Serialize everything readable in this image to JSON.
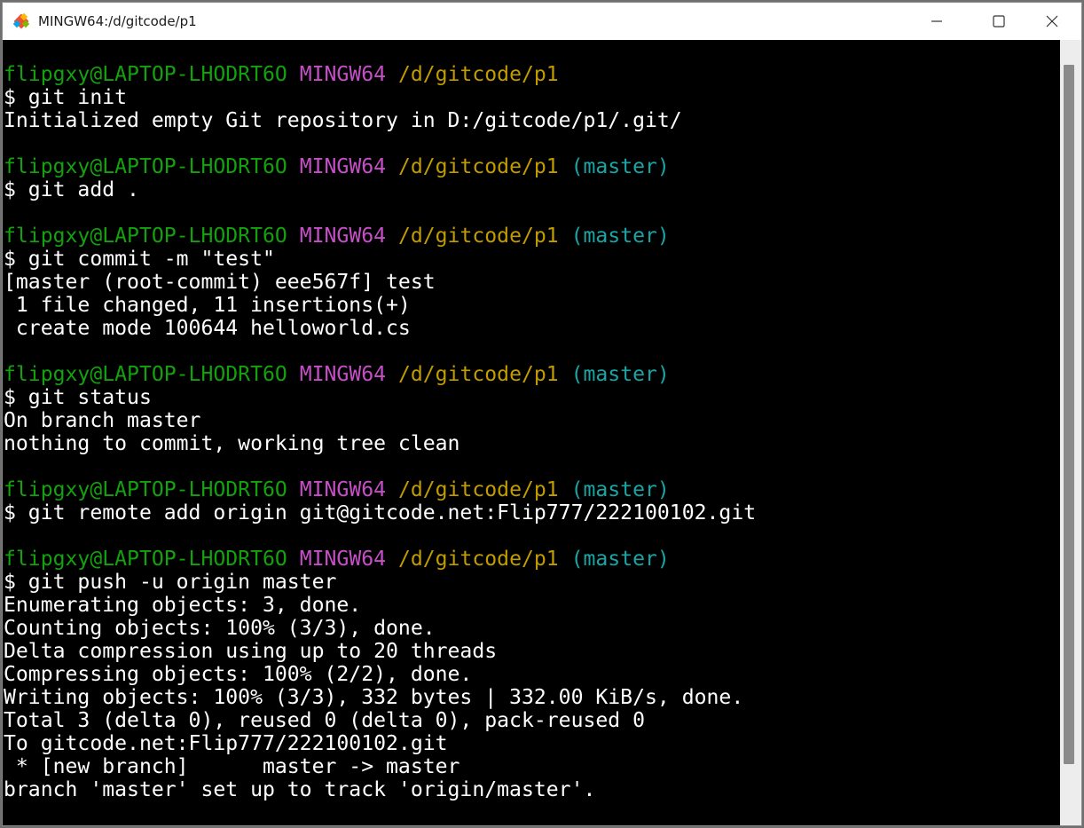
{
  "window": {
    "title": "MINGW64:/d/gitcode/p1"
  },
  "colors": {
    "user": "#13a10e",
    "host": "#c64fc8",
    "path": "#c19c00",
    "branch": "#19a5a5",
    "text": "#ffffff",
    "background": "#000000"
  },
  "icons": {
    "app": "git-icon",
    "minimize": "minimize-icon",
    "maximize": "maximize-icon",
    "close": "close-icon"
  },
  "blocks": [
    {
      "prompt": {
        "user": "flipgxy@LAPTOP-LHODRT6O",
        "host": "MINGW64",
        "path": "/d/gitcode/p1",
        "branch": ""
      },
      "command": "$ git init",
      "output": [
        "Initialized empty Git repository in D:/gitcode/p1/.git/"
      ]
    },
    {
      "prompt": {
        "user": "flipgxy@LAPTOP-LHODRT6O",
        "host": "MINGW64",
        "path": "/d/gitcode/p1",
        "branch": "(master)"
      },
      "command": "$ git add .",
      "output": []
    },
    {
      "prompt": {
        "user": "flipgxy@LAPTOP-LHODRT6O",
        "host": "MINGW64",
        "path": "/d/gitcode/p1",
        "branch": "(master)"
      },
      "command": "$ git commit -m \"test\"",
      "output": [
        "[master (root-commit) eee567f] test",
        " 1 file changed, 11 insertions(+)",
        " create mode 100644 helloworld.cs"
      ]
    },
    {
      "prompt": {
        "user": "flipgxy@LAPTOP-LHODRT6O",
        "host": "MINGW64",
        "path": "/d/gitcode/p1",
        "branch": "(master)"
      },
      "command": "$ git status",
      "output": [
        "On branch master",
        "nothing to commit, working tree clean"
      ]
    },
    {
      "prompt": {
        "user": "flipgxy@LAPTOP-LHODRT6O",
        "host": "MINGW64",
        "path": "/d/gitcode/p1",
        "branch": "(master)"
      },
      "command": "$ git remote add origin git@gitcode.net:Flip777/222100102.git",
      "output": []
    },
    {
      "prompt": {
        "user": "flipgxy@LAPTOP-LHODRT6O",
        "host": "MINGW64",
        "path": "/d/gitcode/p1",
        "branch": "(master)"
      },
      "command": "$ git push -u origin master",
      "output": [
        "Enumerating objects: 3, done.",
        "Counting objects: 100% (3/3), done.",
        "Delta compression using up to 20 threads",
        "Compressing objects: 100% (2/2), done.",
        "Writing objects: 100% (3/3), 332 bytes | 332.00 KiB/s, done.",
        "Total 3 (delta 0), reused 0 (delta 0), pack-reused 0",
        "To gitcode.net:Flip777/222100102.git",
        " * [new branch]      master -> master",
        "branch 'master' set up to track 'origin/master'."
      ]
    }
  ]
}
